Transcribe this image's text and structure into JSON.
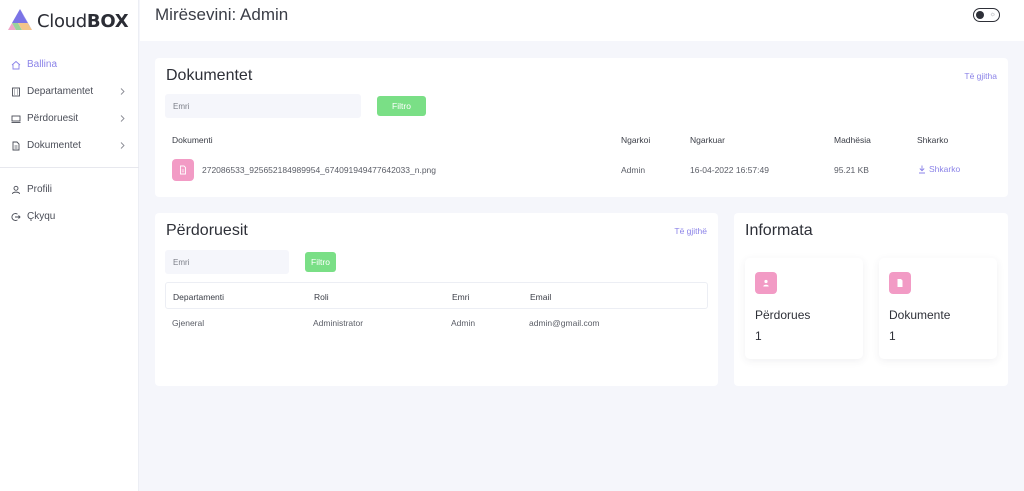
{
  "brand": {
    "name_light": "Cloud",
    "name_bold": "BOX"
  },
  "sidebar": {
    "items": [
      {
        "label": "Ballina",
        "icon": "home-icon",
        "active": true
      },
      {
        "label": "Departamentet",
        "icon": "building-icon",
        "has_submenu": true
      },
      {
        "label": "Përdoruesit",
        "icon": "monitor-icon",
        "has_submenu": true
      },
      {
        "label": "Dokumentet",
        "icon": "document-icon",
        "has_submenu": true
      }
    ],
    "bottom_items": [
      {
        "label": "Profili",
        "icon": "user-icon"
      },
      {
        "label": "Çkyqu",
        "icon": "logout-icon"
      }
    ]
  },
  "header": {
    "title": "Mirësevini: Admin",
    "theme_toggle": "off"
  },
  "documents": {
    "title": "Dokumentet",
    "see_all": "Të gjitha",
    "search_placeholder": "Emri",
    "filter_label": "Filtro",
    "columns": [
      "Dokumenti",
      "Ngarkoi",
      "Ngarkuar",
      "Madhësia",
      "Shkarko"
    ],
    "rows": [
      {
        "name": "272086533_925652184989954_674091949477642033_n.png",
        "uploader": "Admin",
        "uploaded": "16-04-2022 16:57:49",
        "size": "95.21 KB",
        "download": "Shkarko"
      }
    ]
  },
  "users": {
    "title": "Përdoruesit",
    "see_all": "Të gjithë",
    "search_placeholder": "Emri",
    "filter_label": "Filtro",
    "columns": [
      "Departamenti",
      "Roli",
      "Emri",
      "Email"
    ],
    "rows": [
      {
        "department": "Gjeneral",
        "role": "Administrator",
        "name": "Admin",
        "email": "admin@gmail.com"
      }
    ]
  },
  "info": {
    "title": "Informata",
    "stats": [
      {
        "label": "Përdorues",
        "value": "1",
        "icon": "user-icon"
      },
      {
        "label": "Dokumente",
        "value": "1",
        "icon": "document-icon"
      }
    ]
  },
  "colors": {
    "accent": "#8b83e8",
    "filter_button": "#7adf86",
    "badge": "#f29bc5",
    "background": "#f5f6fb"
  }
}
